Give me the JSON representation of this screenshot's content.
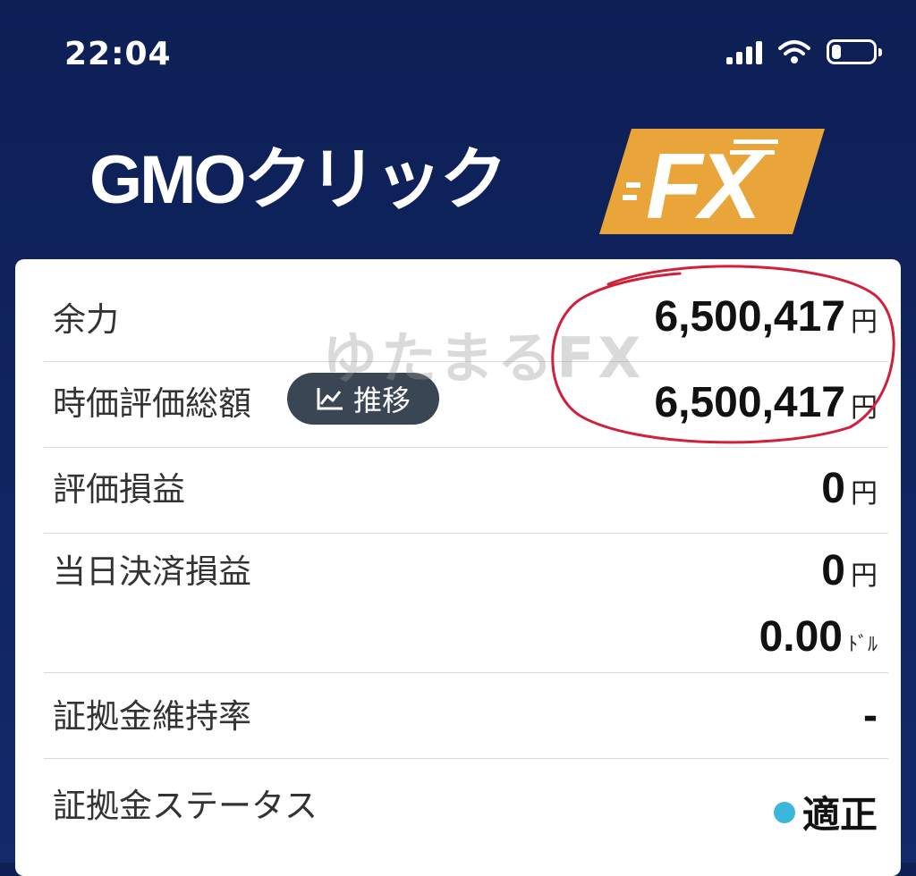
{
  "status_bar": {
    "time": "22:04"
  },
  "logo": {
    "text": "GMOクリック",
    "badge": "FX"
  },
  "rows": [
    {
      "label": "余力",
      "value": "6,500,417",
      "unit": "円"
    },
    {
      "label": "時価評価総額",
      "button": "推移",
      "value": "6,500,417",
      "unit": "円"
    },
    {
      "label": "評価損益",
      "value": "0",
      "unit": "円"
    },
    {
      "label": "当日決済損益",
      "value": "0",
      "unit": "円",
      "value2": "0.00",
      "unit2": "ﾄﾞﾙ"
    },
    {
      "label": "証拠金維持率",
      "value": "-"
    },
    {
      "label": "証拠金ステータス",
      "status": "適正"
    }
  ],
  "watermark": "ゆたまるFX",
  "colors": {
    "header": "#0d1f55",
    "badge": "#e9a43a",
    "annotation": "#d0203a",
    "status_dot": "#3cb6dc"
  }
}
